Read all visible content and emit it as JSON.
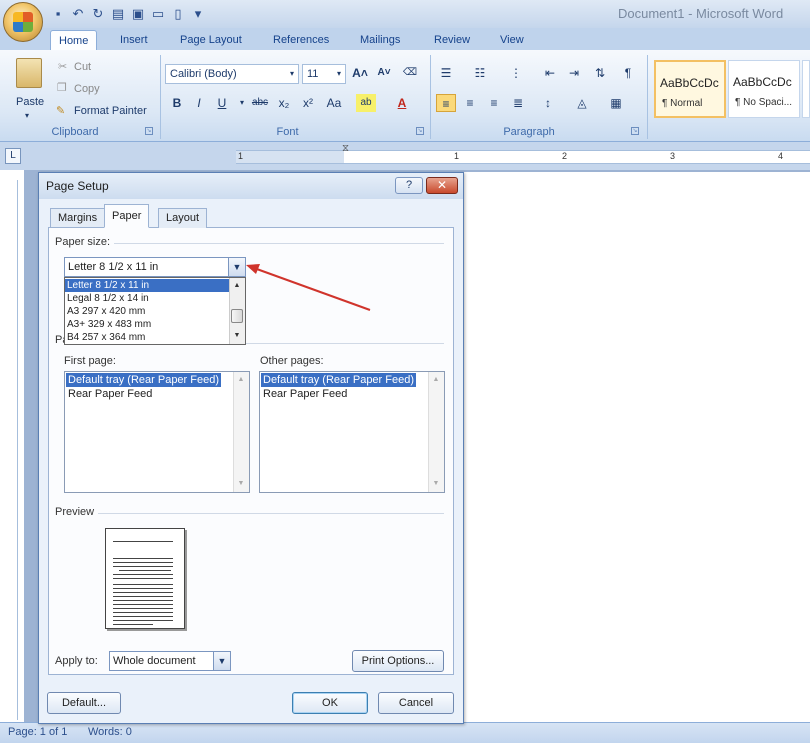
{
  "app": {
    "title": "Document1 - Microsoft Word"
  },
  "ribbon": {
    "tabs": [
      "Home",
      "Insert",
      "Page Layout",
      "References",
      "Mailings",
      "Review",
      "View"
    ],
    "clipboard": {
      "label": "Clipboard",
      "paste": "Paste",
      "cut": "Cut",
      "copy": "Copy",
      "format_painter": "Format Painter"
    },
    "font": {
      "label": "Font",
      "font_name": "Calibri (Body)",
      "font_size": "11"
    },
    "paragraph": {
      "label": "Paragraph"
    },
    "styles": [
      {
        "preview": "AaBbCcDc",
        "name": "¶ Normal"
      },
      {
        "preview": "AaBbCcDc",
        "name": "¶ No Spaci..."
      }
    ]
  },
  "ruler": {
    "numbers": [
      "1",
      "1",
      "2",
      "3",
      "4"
    ]
  },
  "status": {
    "page": "Page: 1 of 1",
    "words": "Words: 0"
  },
  "dialog": {
    "title": "Page Setup",
    "help": "?",
    "close": "✕",
    "tabs": [
      "Margins",
      "Paper",
      "Layout"
    ],
    "paper_size_label": "Paper size:",
    "paper_size_value": "Letter 8 1/2 x 11 in",
    "paper_list": [
      "Letter 8 1/2 x 11 in",
      "Legal 8 1/2 x 14 in",
      "A3 297 x 420 mm",
      "A3+ 329 x 483 mm",
      "B4 257 x 364 mm"
    ],
    "paper_source_label_visible": "Pa",
    "first_page_label": "First page:",
    "other_pages_label": "Other pages:",
    "trays": [
      "Default tray (Rear Paper Feed)",
      "Rear Paper Feed"
    ],
    "preview_label": "Preview",
    "apply_to_label": "Apply to:",
    "apply_to_value": "Whole document",
    "print_options": "Print Options...",
    "default_btn": "Default...",
    "ok_btn": "OK",
    "cancel_btn": "Cancel"
  },
  "colors": {
    "selection": "#3a6fc4",
    "annotation_arrow": "#d0342c"
  }
}
